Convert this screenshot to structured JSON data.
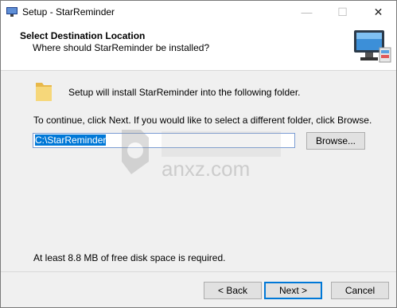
{
  "window": {
    "title": "Setup - StarReminder"
  },
  "titlebar": {
    "minimize_glyph": "—",
    "maximize_glyph": "☐",
    "close_glyph": "✕"
  },
  "header": {
    "title": "Select Destination Location",
    "subtitle": "Where should StarReminder be installed?",
    "image_icon": "computer-monitor-icon"
  },
  "body": {
    "folder_icon": "folder-icon",
    "intro": "Setup will install StarReminder into the following folder.",
    "instructions": "To continue, click Next. If you would like to select a different folder, click Browse.",
    "path_value": "C:\\StarReminder",
    "browse_label": "Browse...",
    "disk_space": "At least 8.8 MB of free disk space is required."
  },
  "watermark": {
    "text": "anxz.com"
  },
  "footer": {
    "back_label": "< Back",
    "next_label": "Next >",
    "cancel_label": "Cancel"
  },
  "colors": {
    "accent": "#0078d7",
    "panel": "#f0f0f0"
  }
}
